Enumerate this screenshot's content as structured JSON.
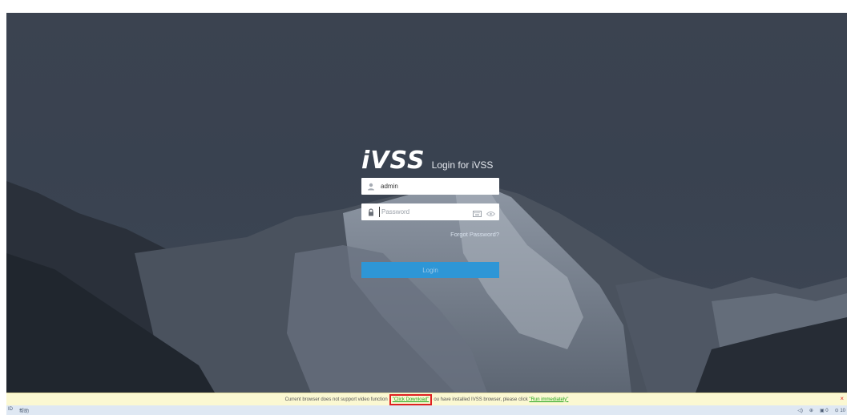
{
  "login": {
    "logo": "iVSS",
    "caption": "Login for iVSS",
    "username_value": "admin",
    "password_placeholder": "Password",
    "forgot_label": "Forgot Password?",
    "login_label": "Login"
  },
  "notice": {
    "text_before": "Current browser does not support video function",
    "download_link": "\"Click Download\"",
    "text_middle": "ou have installed IVSS browser, please click",
    "run_link": "\"Run immediately\"",
    "close_glyph": "×"
  },
  "taskbar": {
    "left_items": [
      "ID",
      "帮助"
    ],
    "right_items": [
      "◁)",
      "⊕",
      "▣ 0",
      "⊙ 10"
    ]
  },
  "colors": {
    "background": "#3b4350",
    "login_button": "#2e96d6",
    "notice_bg": "#fbf8d2",
    "link": "#1fa318",
    "highlight": "#e02020"
  }
}
